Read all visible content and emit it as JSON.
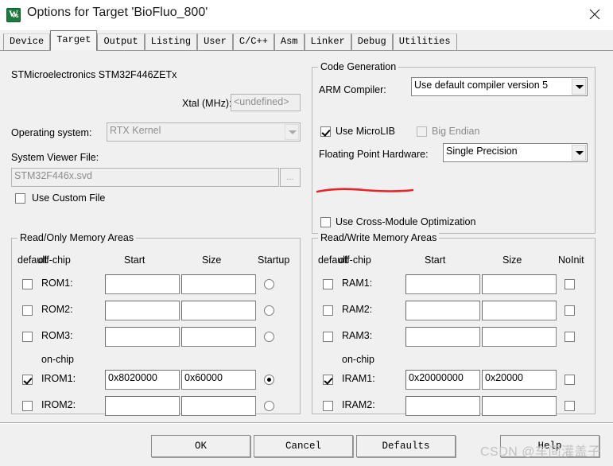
{
  "window": {
    "title": "Options for Target 'BioFluo_800'",
    "icon": "keil-uvision-icon",
    "close_label": "✕"
  },
  "tabs": [
    {
      "label": "Device",
      "active": false
    },
    {
      "label": "Target",
      "active": true
    },
    {
      "label": "Output",
      "active": false
    },
    {
      "label": "Listing",
      "active": false
    },
    {
      "label": "User",
      "active": false
    },
    {
      "label": "C/C++",
      "active": false
    },
    {
      "label": "Asm",
      "active": false
    },
    {
      "label": "Linker",
      "active": false
    },
    {
      "label": "Debug",
      "active": false
    },
    {
      "label": "Utilities",
      "active": false
    }
  ],
  "device": {
    "name": "STMicroelectronics STM32F446ZETx",
    "xtal_label": "Xtal (MHz):",
    "xtal_value": "<undefined>",
    "os_label": "Operating system:",
    "os_value": "RTX Kernel",
    "svf_label": "System Viewer File:",
    "svf_value": "STM32F446x.svd",
    "browse_label": "...",
    "use_custom_file_label": "Use Custom File",
    "use_custom_file_checked": false
  },
  "code_generation": {
    "title": "Code Generation",
    "arm_compiler_label": "ARM Compiler:",
    "arm_compiler_value": "Use default compiler version 5",
    "use_microlib_label": "Use MicroLIB",
    "use_microlib_checked": true,
    "big_endian_label": "Big Endian",
    "big_endian_checked": false,
    "big_endian_disabled": true,
    "fpu_label": "Floating Point Hardware:",
    "fpu_value": "Single Precision",
    "cross_module_label": "Use Cross-Module Optimization",
    "cross_module_checked": false
  },
  "annotation": {
    "color": "#e8232a",
    "target": "use-microlib-checkbox"
  },
  "readonly_memory": {
    "title": "Read/Only Memory Areas",
    "headers": [
      "default",
      "off-chip",
      "Start",
      "Size",
      "Startup"
    ],
    "onchip_label": "on-chip",
    "rows": [
      {
        "name": "ROM1:",
        "default": false,
        "start": "",
        "size": "",
        "startup": false
      },
      {
        "name": "ROM2:",
        "default": false,
        "start": "",
        "size": "",
        "startup": false
      },
      {
        "name": "ROM3:",
        "default": false,
        "start": "",
        "size": "",
        "startup": false
      },
      {
        "name": "IROM1:",
        "default": true,
        "start": "0x8020000",
        "size": "0x60000",
        "startup": true
      },
      {
        "name": "IROM2:",
        "default": false,
        "start": "",
        "size": "",
        "startup": false
      }
    ]
  },
  "readwrite_memory": {
    "title": "Read/Write Memory Areas",
    "headers": [
      "default",
      "off-chip",
      "Start",
      "Size",
      "NoInit"
    ],
    "onchip_label": "on-chip",
    "rows": [
      {
        "name": "RAM1:",
        "default": false,
        "start": "",
        "size": "",
        "noinit": false
      },
      {
        "name": "RAM2:",
        "default": false,
        "start": "",
        "size": "",
        "noinit": false
      },
      {
        "name": "RAM3:",
        "default": false,
        "start": "",
        "size": "",
        "noinit": false
      },
      {
        "name": "IRAM1:",
        "default": true,
        "start": "0x20000000",
        "size": "0x20000",
        "noinit": false
      },
      {
        "name": "IRAM2:",
        "default": false,
        "start": "",
        "size": "",
        "noinit": false
      }
    ]
  },
  "footer": {
    "ok": "OK",
    "cancel": "Cancel",
    "defaults": "Defaults",
    "help": "Help",
    "watermark": "CSDN @车间灌盖子"
  }
}
